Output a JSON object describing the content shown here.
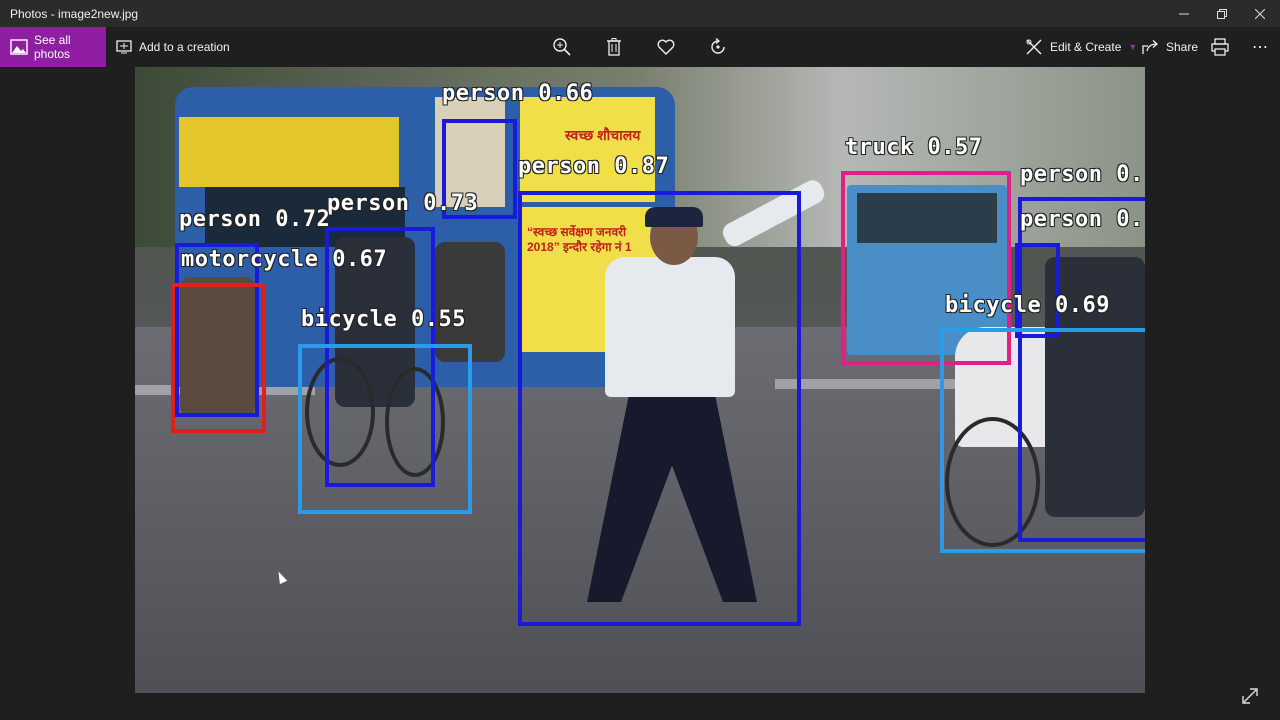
{
  "window": {
    "title": "Photos - image2new.jpg",
    "controls": [
      "minimize",
      "restore",
      "close"
    ]
  },
  "toolbar": {
    "see_all_label": "See all photos",
    "add_creation_label": "Add to a creation",
    "center_icons": [
      "zoom-in-icon",
      "delete-icon",
      "heart-icon",
      "rotate-icon"
    ],
    "edit_create_label": "Edit & Create",
    "share_label": "Share",
    "accent": "#8f1ea3"
  },
  "detections": [
    {
      "label": "person 0.66",
      "color": "#1a1adb"
    },
    {
      "label": "person 0.87",
      "color": "#1a1adb"
    },
    {
      "label": "person 0.73",
      "color": "#1a1adb"
    },
    {
      "label": "person 0.72",
      "color": "#1a1adb"
    },
    {
      "label": "motorcycle 0.67",
      "color": "#e0201a"
    },
    {
      "label": "bicycle 0.55",
      "color": "#2a9be8"
    },
    {
      "label": "truck 0.57",
      "color": "#e01f8a"
    },
    {
      "label": "person 0.",
      "color": "#1a1adb"
    },
    {
      "label": "person 0.",
      "color": "#1a1adb"
    },
    {
      "label": "bicycle 0.69",
      "color": "#2a9be8"
    }
  ],
  "scene_text": {
    "bus_panel": "“स्वच्छ सर्वेक्षण जनवरी 2018” इन्दौर रहेगा नं 1",
    "bus_top": "स्वच्छ शौचालय"
  }
}
